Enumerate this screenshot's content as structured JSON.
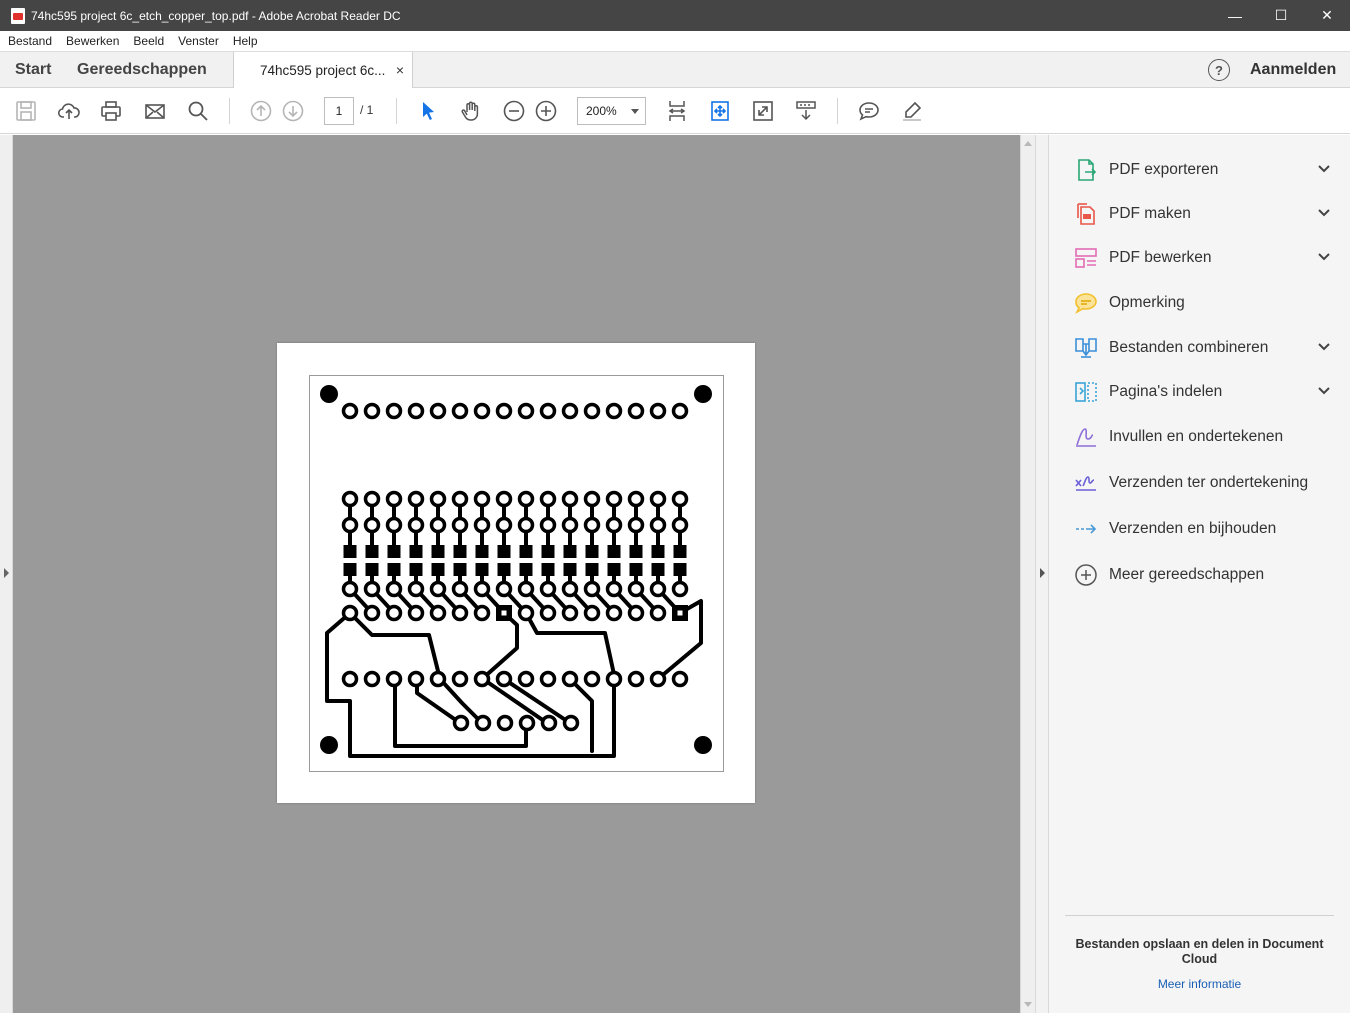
{
  "window": {
    "title": "74hc595 project 6c_etch_copper_top.pdf - Adobe Acrobat Reader DC",
    "minimize": "—",
    "maximize": "☐",
    "close": "✕"
  },
  "menu": [
    "Bestand",
    "Bewerken",
    "Beeld",
    "Venster",
    "Help"
  ],
  "tabs": {
    "start": "Start",
    "tools": "Gereedschappen",
    "document": "74hc595 project 6c...",
    "close": "×",
    "help": "?",
    "login": "Aanmelden"
  },
  "toolbar": {
    "page_current": "1",
    "page_total": "/ 1",
    "zoom": "200%"
  },
  "tools_panel": {
    "items": [
      {
        "label": "PDF exporteren",
        "icon": "export-pdf-icon",
        "expandable": true,
        "color": "#2aa676"
      },
      {
        "label": "PDF maken",
        "icon": "create-pdf-icon",
        "expandable": true,
        "color": "#e8574a"
      },
      {
        "label": "PDF bewerken",
        "icon": "edit-pdf-icon",
        "expandable": true,
        "color": "#e36cb6"
      },
      {
        "label": "Opmerking",
        "icon": "comment-icon",
        "expandable": false,
        "color": "#f2c02e"
      },
      {
        "label": "Bestanden combineren",
        "icon": "combine-files-icon",
        "expandable": true,
        "color": "#3b8fd9"
      },
      {
        "label": "Pagina's indelen",
        "icon": "organize-pages-icon",
        "expandable": true,
        "color": "#3aa5d8"
      },
      {
        "label": "Invullen en ondertekenen",
        "icon": "fill-sign-icon",
        "expandable": false,
        "color": "#8e6fd8"
      },
      {
        "label": "Verzenden ter ondertekening",
        "icon": "send-signature-icon",
        "expandable": false,
        "color": "#6a5fd6"
      },
      {
        "label": "Verzenden en bijhouden",
        "icon": "send-track-icon",
        "expandable": false,
        "color": "#4a9ad6"
      },
      {
        "label": "Meer gereedschappen",
        "icon": "more-tools-icon",
        "expandable": false,
        "color": "#555555"
      }
    ],
    "cloud_text": "Bestanden opslaan en delen in Document Cloud",
    "more_info": "Meer informatie"
  }
}
